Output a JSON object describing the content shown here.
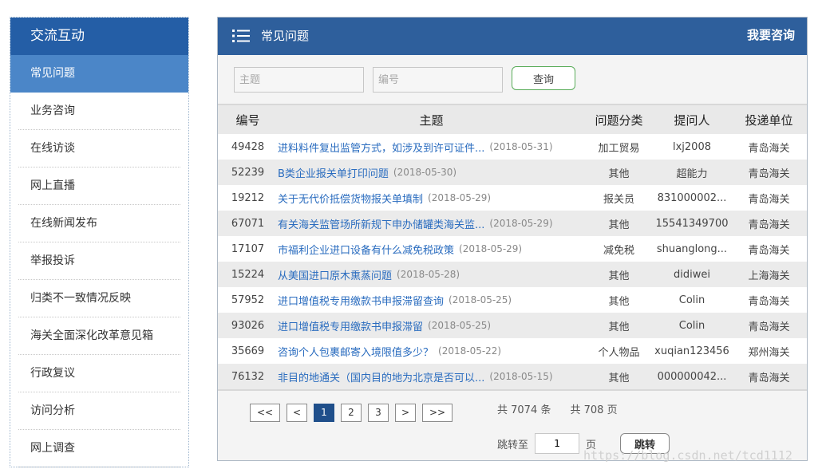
{
  "sidebar": {
    "title": "交流互动",
    "items": [
      {
        "label": "常见问题",
        "active": true
      },
      {
        "label": "业务咨询"
      },
      {
        "label": "在线访谈"
      },
      {
        "label": "网上直播"
      },
      {
        "label": "在线新闻发布"
      },
      {
        "label": "举报投诉"
      },
      {
        "label": "归类不一致情况反映"
      },
      {
        "label": "海关全面深化改革意见箱"
      },
      {
        "label": "行政复议"
      },
      {
        "label": "访问分析"
      },
      {
        "label": "网上调查"
      }
    ]
  },
  "header": {
    "icon": "list-icon",
    "title": "常见问题",
    "consult_link": "我要咨询"
  },
  "search": {
    "subject_placeholder": "主题",
    "id_placeholder": "编号",
    "button": "查询"
  },
  "table": {
    "columns": [
      "编号",
      "主题",
      "问题分类",
      "提问人",
      "投递单位"
    ],
    "rows": [
      {
        "id": "49428",
        "subject": "进料料件复出监管方式，如涉及到许可证件...",
        "date": "(2018-05-31)",
        "category": "加工贸易",
        "asker": "lxj2008",
        "unit": "青岛海关"
      },
      {
        "id": "52239",
        "subject": "B类企业报关单打印问题",
        "date": "(2018-05-30)",
        "category": "其他",
        "asker": "超能力",
        "unit": "青岛海关"
      },
      {
        "id": "19212",
        "subject": "关于无代价抵偿货物报关单填制",
        "date": "(2018-05-29)",
        "category": "报关员",
        "asker": "831000002...",
        "unit": "青岛海关"
      },
      {
        "id": "67071",
        "subject": "有关海关监管场所新规下申办储罐类海关监...",
        "date": "(2018-05-29)",
        "category": "其他",
        "asker": "15541349700",
        "unit": "青岛海关"
      },
      {
        "id": "17107",
        "subject": "市福利企业进口设备有什么减免税政策",
        "date": "(2018-05-29)",
        "category": "减免税",
        "asker": "shuanglong...",
        "unit": "青岛海关"
      },
      {
        "id": "15224",
        "subject": "从美国进口原木熏蒸问题",
        "date": "(2018-05-28)",
        "category": "其他",
        "asker": "didiwei",
        "unit": "上海海关"
      },
      {
        "id": "57952",
        "subject": "进口增值税专用缴款书申报滞留查询",
        "date": "(2018-05-25)",
        "category": "其他",
        "asker": "Colin",
        "unit": "青岛海关"
      },
      {
        "id": "93026",
        "subject": "进口增值税专用缴款书申报滞留",
        "date": "(2018-05-25)",
        "category": "其他",
        "asker": "Colin",
        "unit": "青岛海关"
      },
      {
        "id": "35669",
        "subject": "咨询个人包裹邮寄入境限值多少？",
        "date": "(2018-05-22)",
        "category": "个人物品",
        "asker": "xuqian123456",
        "unit": "郑州海关"
      },
      {
        "id": "76132",
        "subject": "非目的地通关（国内目的地为北京是否可以...",
        "date": "(2018-05-15)",
        "category": "其他",
        "asker": "000000042...",
        "unit": "青岛海关"
      }
    ]
  },
  "pagination": {
    "first": "<<",
    "prev": "<",
    "pages": [
      "1",
      "2",
      "3"
    ],
    "current": "1",
    "next": ">",
    "last": ">>",
    "total_records": "共 7074 条",
    "total_pages": "共 708 页",
    "jump_label": "跳转至",
    "jump_value": "1",
    "jump_unit": "页",
    "jump_button": "跳转"
  },
  "watermark": "https://blog.csdn.net/tcd1112"
}
